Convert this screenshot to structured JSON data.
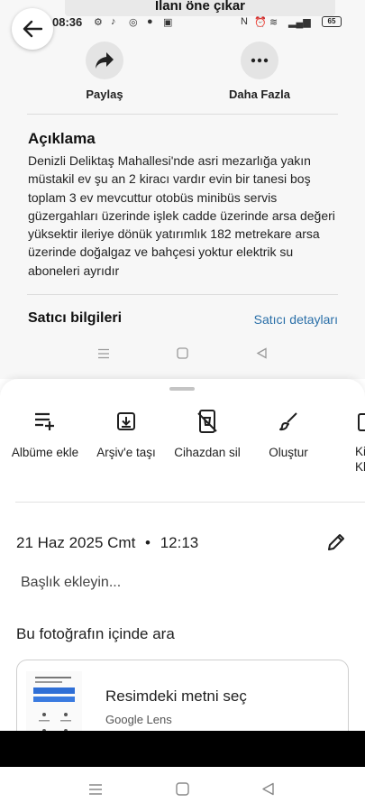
{
  "banner": {
    "text": "İlanı öne çıkar"
  },
  "status_bar": {
    "time": "08:36",
    "battery": "65"
  },
  "actions": {
    "share_label": "Paylaş",
    "more_label": "Daha Fazla"
  },
  "description": {
    "title": "Açıklama",
    "body": "Denizli Deliktaş Mahallesi'nde asri mezarlığa yakın müstakil ev şu an 2 kiracı vardır evin bir tanesi boş toplam 3 ev mevcuttur otobüs minibüs servis güzergahları üzerinde işlek cadde üzerinde arsa değeri yüksektir ileriye dönük yatırımlık 182 metrekare arsa üzerinde doğalgaz ve bahçesi yoktur elektrik su aboneleri ayrıdır"
  },
  "seller": {
    "title": "Satıcı bilgileri",
    "link": "Satıcı detayları"
  },
  "sheet": {
    "tools": [
      {
        "label": "Albüme ekle",
        "icon": "playlist-add-icon"
      },
      {
        "label": "Arşiv'e taşı",
        "icon": "archive-icon"
      },
      {
        "label": "Cihazdan sil",
        "icon": "device-delete-icon"
      },
      {
        "label": "Oluştur",
        "icon": "brush-icon"
      },
      {
        "label": "Ki\nKlasö",
        "icon": "folder-icon"
      }
    ],
    "date": "21 Haz 2025 Cmt",
    "time": "12:13",
    "title_placeholder": "Başlık ekleyin...",
    "search_heading": "Bu fotoğrafın içinde ara",
    "lens": {
      "title": "Resimdeki metni seç",
      "subtitle": "Google Lens"
    }
  }
}
